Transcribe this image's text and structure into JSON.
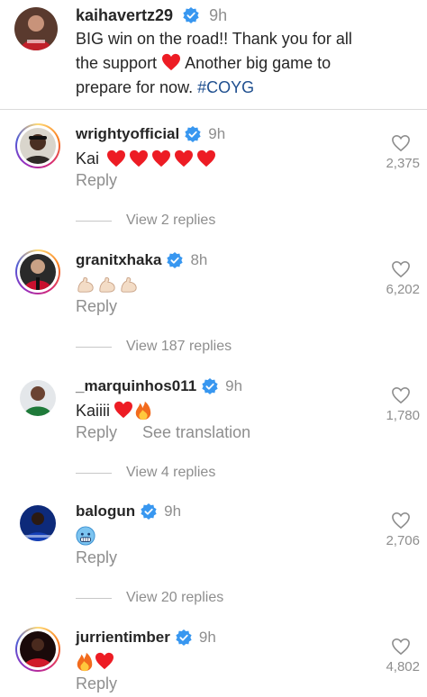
{
  "caption": {
    "username": "kaihavertz29",
    "time": "9h",
    "text_line1": "BIG win on the road!! Thank you for all",
    "text_line2_a": "the support",
    "text_line2_b": " Another big game to",
    "text_line3_a": "prepare for now. ",
    "hashtag": "#COYG"
  },
  "comments": [
    {
      "username": "wrightyofficial",
      "time": "9h",
      "text": "Kai",
      "emojis": "hearts-5",
      "reply": "Reply",
      "likes": "2,375",
      "replies": "View 2 replies"
    },
    {
      "username": "granitxhaka",
      "time": "8h",
      "text": "",
      "emojis": "flexed-biceps-3",
      "reply": "Reply",
      "likes": "6,202",
      "replies": "View 187 replies"
    },
    {
      "username": "_marquinhos011",
      "time": "9h",
      "text": "Kaiiii",
      "emojis": "heart-fire",
      "reply": "Reply",
      "translate": "See translation",
      "likes": "1,780",
      "replies": "View 4 replies"
    },
    {
      "username": "balogun",
      "time": "9h",
      "text": "",
      "emojis": "cold-face",
      "reply": "Reply",
      "likes": "2,706",
      "replies": "View 20 replies"
    },
    {
      "username": "jurrientimber",
      "time": "9h",
      "text": "",
      "emojis": "fire-heart",
      "reply": "Reply",
      "likes": "4,802"
    }
  ],
  "colors": {
    "verified": "#3897f0",
    "heart": "#ed1c24",
    "muted": "#8e8e8e",
    "hashtag": "#1f4f8f"
  }
}
